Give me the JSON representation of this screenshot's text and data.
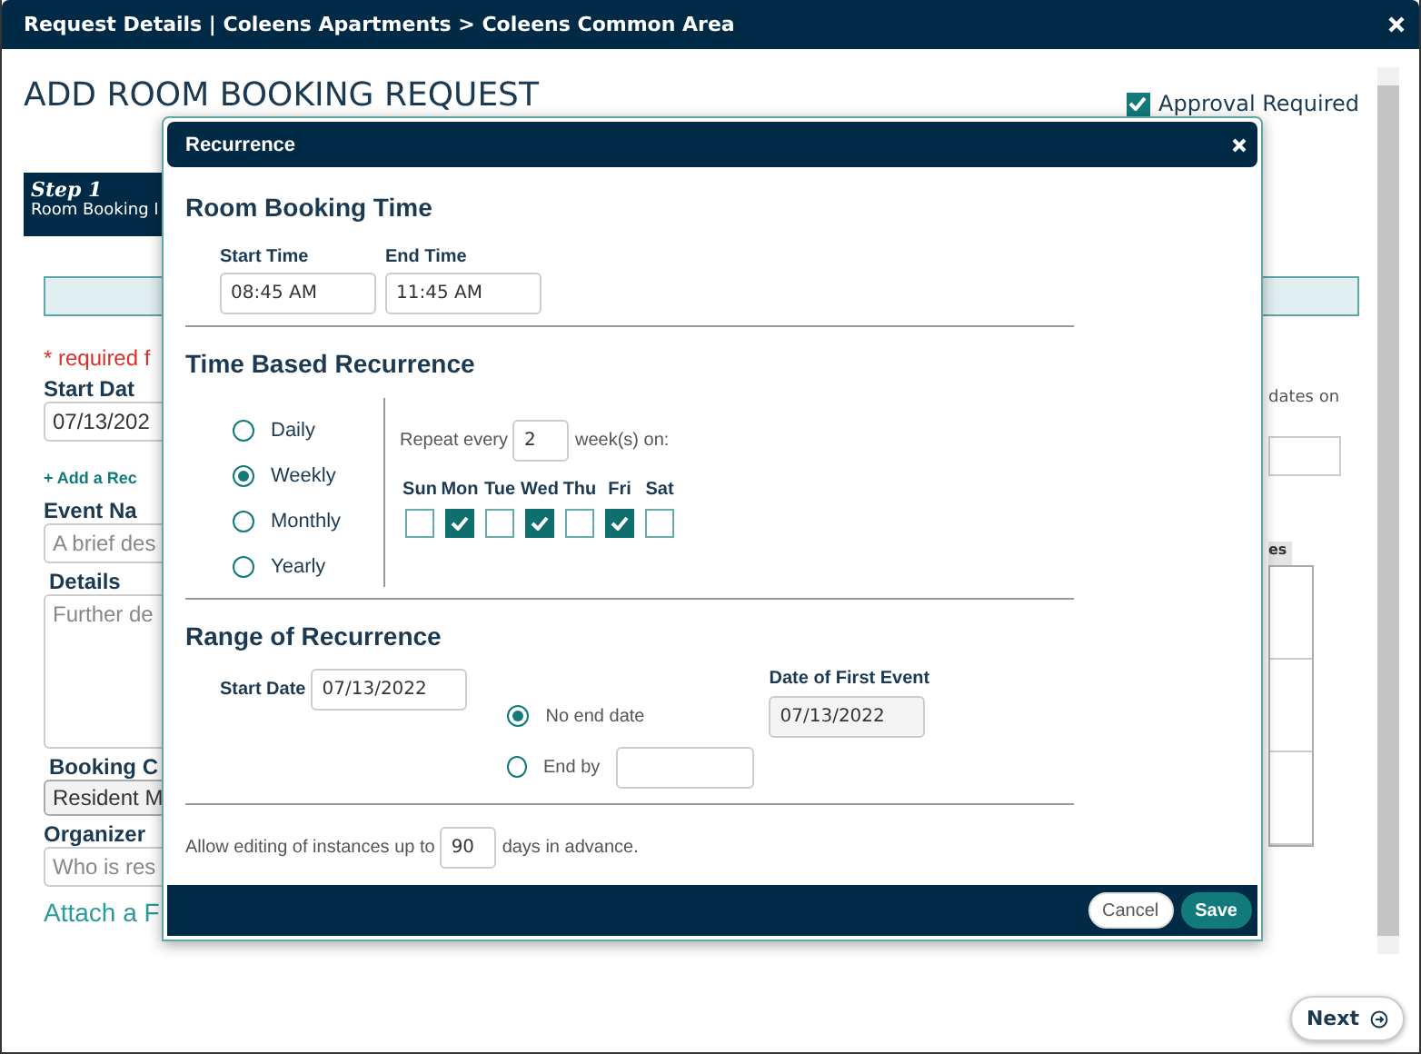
{
  "window": {
    "title": "Request Details | Coleens Apartments > Coleens Common Area"
  },
  "page": {
    "heading": "ADD ROOM BOOKING REQUEST",
    "approval": {
      "label": "Approval Required",
      "checked": true
    },
    "step": {
      "title": "Step 1",
      "subtitle": "Room Booking I"
    },
    "required_note": "* required f",
    "fields": [
      {
        "kind": "input",
        "label": "Start Dat",
        "value": "07/13/202"
      },
      {
        "kind": "link",
        "text": "+ Add a Rec"
      },
      {
        "kind": "input",
        "label": "Event Na",
        "placeholder": "A brief des"
      },
      {
        "kind": "textarea",
        "label": "Details",
        "placeholder": "Further de"
      },
      {
        "kind": "select",
        "label": "Booking C",
        "value": "Resident M"
      },
      {
        "kind": "input",
        "label": "Organizer",
        "placeholder": "Who is res"
      },
      {
        "kind": "attach",
        "text": "Attach a F"
      }
    ],
    "side_note": "dates on",
    "side_tab": "es",
    "next_button": "Next"
  },
  "modal": {
    "title": "Recurrence",
    "time": {
      "heading": "Room Booking Time",
      "start_label": "Start Time",
      "start_value": "08:45 AM",
      "end_label": "End Time",
      "end_value": "11:45 AM"
    },
    "recurrence": {
      "heading": "Time Based Recurrence",
      "options": [
        {
          "label": "Daily",
          "selected": false
        },
        {
          "label": "Weekly",
          "selected": true
        },
        {
          "label": "Monthly",
          "selected": false
        },
        {
          "label": "Yearly",
          "selected": false
        }
      ],
      "repeat_label": "Repeat every",
      "repeat_value": "2",
      "repeat_unit": "week(s) on:",
      "days": [
        {
          "label": "Sun",
          "checked": false
        },
        {
          "label": "Mon",
          "checked": true
        },
        {
          "label": "Tue",
          "checked": false
        },
        {
          "label": "Wed",
          "checked": true
        },
        {
          "label": "Thu",
          "checked": false
        },
        {
          "label": "Fri",
          "checked": true
        },
        {
          "label": "Sat",
          "checked": false
        }
      ]
    },
    "range": {
      "heading": "Range of Recurrence",
      "start_label": "Start Date",
      "start_value": "07/13/2022",
      "end_options": [
        {
          "kind": "plain",
          "label": "No end date",
          "selected": true
        },
        {
          "kind": "date_field",
          "label": "End by",
          "selected": false
        }
      ],
      "first_event_label": "Date of First Event",
      "first_event_value": "07/13/2022"
    },
    "advance": {
      "before": "Allow editing of instances up to",
      "value": "90",
      "after": "days in advance."
    },
    "buttons": [
      {
        "kind": "secondary",
        "label": "Cancel"
      },
      {
        "kind": "primary",
        "label": "Save"
      }
    ]
  }
}
